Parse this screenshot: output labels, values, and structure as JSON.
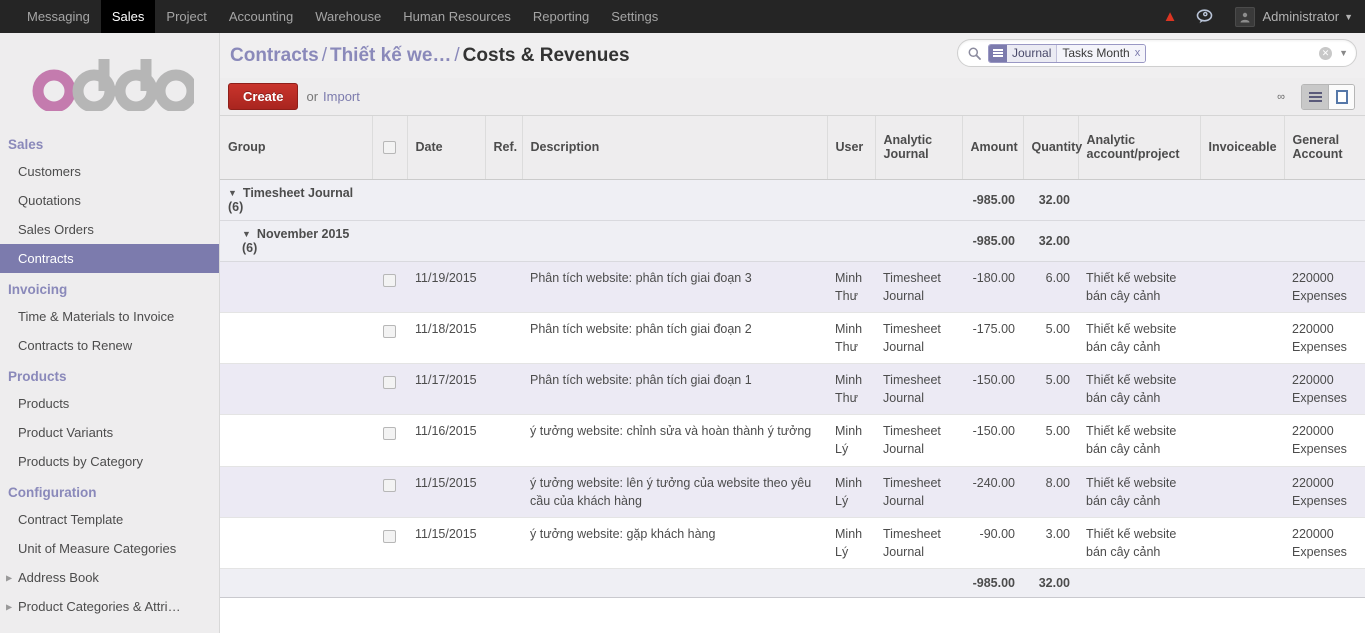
{
  "topnav": {
    "items": [
      {
        "label": "Messaging",
        "active": false
      },
      {
        "label": "Sales",
        "active": true
      },
      {
        "label": "Project",
        "active": false
      },
      {
        "label": "Accounting",
        "active": false
      },
      {
        "label": "Warehouse",
        "active": false
      },
      {
        "label": "Human Resources",
        "active": false
      },
      {
        "label": "Reporting",
        "active": false
      },
      {
        "label": "Settings",
        "active": false
      }
    ],
    "user": "Administrator",
    "warning_icon": "warning-triangle-icon",
    "chat_icon": "chat-bubble-icon",
    "avatar_icon": "user-avatar-icon"
  },
  "logo": {
    "text_o1": "o",
    "text_rest": "doo",
    "accent_color": "#c47bae",
    "gray_color": "#b6b6b6"
  },
  "sidebar": {
    "groups": [
      {
        "title": "Sales",
        "items": [
          {
            "label": "Customers",
            "active": false,
            "expandable": false
          },
          {
            "label": "Quotations",
            "active": false,
            "expandable": false
          },
          {
            "label": "Sales Orders",
            "active": false,
            "expandable": false
          },
          {
            "label": "Contracts",
            "active": true,
            "expandable": false
          }
        ]
      },
      {
        "title": "Invoicing",
        "items": [
          {
            "label": "Time & Materials to Invoice",
            "active": false,
            "expandable": false
          },
          {
            "label": "Contracts to Renew",
            "active": false,
            "expandable": false
          }
        ]
      },
      {
        "title": "Products",
        "items": [
          {
            "label": "Products",
            "active": false,
            "expandable": false
          },
          {
            "label": "Product Variants",
            "active": false,
            "expandable": false
          },
          {
            "label": "Products by Category",
            "active": false,
            "expandable": false
          }
        ]
      },
      {
        "title": "Configuration",
        "items": [
          {
            "label": "Contract Template",
            "active": false,
            "expandable": false
          },
          {
            "label": "Unit of Measure Categories",
            "active": false,
            "expandable": false
          },
          {
            "label": "Address Book",
            "active": false,
            "expandable": true
          },
          {
            "label": "Product Categories & Attri…",
            "active": false,
            "expandable": true
          }
        ]
      }
    ]
  },
  "breadcrumb": {
    "crumbs": [
      "Contracts",
      "Thiết kế we…"
    ],
    "separator": "/",
    "current": "Costs & Revenues"
  },
  "search": {
    "icon": "search-icon",
    "facet": {
      "icon": "group-by-icon",
      "label": "Journal",
      "value": "Tasks Month",
      "remove": "x"
    },
    "clear_icon": "clear-circle-icon",
    "dropdown_icon": "chevron-down-icon"
  },
  "toolbar": {
    "create_label": "Create",
    "or_label": "or",
    "import_label": "Import",
    "pager_limit": "∞",
    "views": [
      {
        "name": "list-view",
        "icon": "list-icon",
        "active": true
      },
      {
        "name": "form-view",
        "icon": "form-icon",
        "active": false
      }
    ]
  },
  "table": {
    "columns": [
      {
        "label": "Group",
        "align": "left"
      },
      {
        "label": "",
        "align": "center"
      },
      {
        "label": "Date",
        "align": "left"
      },
      {
        "label": "Ref.",
        "align": "left"
      },
      {
        "label": "Description",
        "align": "left"
      },
      {
        "label": "User",
        "align": "left"
      },
      {
        "label": "Analytic Journal",
        "align": "left"
      },
      {
        "label": "Amount",
        "align": "right"
      },
      {
        "label": "Quantity",
        "align": "right"
      },
      {
        "label": "Analytic account/project",
        "align": "left"
      },
      {
        "label": "Invoiceable",
        "align": "left"
      },
      {
        "label": "General Account",
        "align": "left"
      }
    ],
    "groups": [
      {
        "level": 1,
        "name": "Timesheet Journal (6)",
        "amount": "-985.00",
        "quantity": "32.00",
        "expanded": true
      },
      {
        "level": 2,
        "name": "November 2015 (6)",
        "amount": "-985.00",
        "quantity": "32.00",
        "expanded": true
      }
    ],
    "rows": [
      {
        "date": "11/19/2015",
        "ref": "",
        "description": "Phân tích website: phân tích giai đoạn 3",
        "user": "Minh Thư",
        "journal": "Timesheet Journal",
        "amount": "-180.00",
        "quantity": "6.00",
        "project": "Thiết kế website bán cây cảnh",
        "invoiceable": "",
        "account": "220000 Expenses"
      },
      {
        "date": "11/18/2015",
        "ref": "",
        "description": "Phân tích website: phân tích giai đoạn 2",
        "user": "Minh Thư",
        "journal": "Timesheet Journal",
        "amount": "-175.00",
        "quantity": "5.00",
        "project": "Thiết kế website bán cây cảnh",
        "invoiceable": "",
        "account": "220000 Expenses"
      },
      {
        "date": "11/17/2015",
        "ref": "",
        "description": "Phân tích website: phân tích giai đoạn 1",
        "user": "Minh Thư",
        "journal": "Timesheet Journal",
        "amount": "-150.00",
        "quantity": "5.00",
        "project": "Thiết kế website bán cây cảnh",
        "invoiceable": "",
        "account": "220000 Expenses"
      },
      {
        "date": "11/16/2015",
        "ref": "",
        "description": "ý tưởng website: chỉnh sửa và hoàn thành ý tưởng",
        "user": "Minh Lý",
        "journal": "Timesheet Journal",
        "amount": "-150.00",
        "quantity": "5.00",
        "project": "Thiết kế website bán cây cảnh",
        "invoiceable": "",
        "account": "220000 Expenses"
      },
      {
        "date": "11/15/2015",
        "ref": "",
        "description": "ý tưởng website: lên ý tưởng của website theo yêu cầu của khách hàng",
        "user": "Minh Lý",
        "journal": "Timesheet Journal",
        "amount": "-240.00",
        "quantity": "8.00",
        "project": "Thiết kế website bán cây cảnh",
        "invoiceable": "",
        "account": "220000 Expenses"
      },
      {
        "date": "11/15/2015",
        "ref": "",
        "description": "ý tưởng website: gặp khách hàng",
        "user": "Minh Lý",
        "journal": "Timesheet Journal",
        "amount": "-90.00",
        "quantity": "3.00",
        "project": "Thiết kế website bán cây cảnh",
        "invoiceable": "",
        "account": "220000 Expenses"
      }
    ],
    "totals": {
      "amount": "-985.00",
      "quantity": "32.00"
    }
  }
}
